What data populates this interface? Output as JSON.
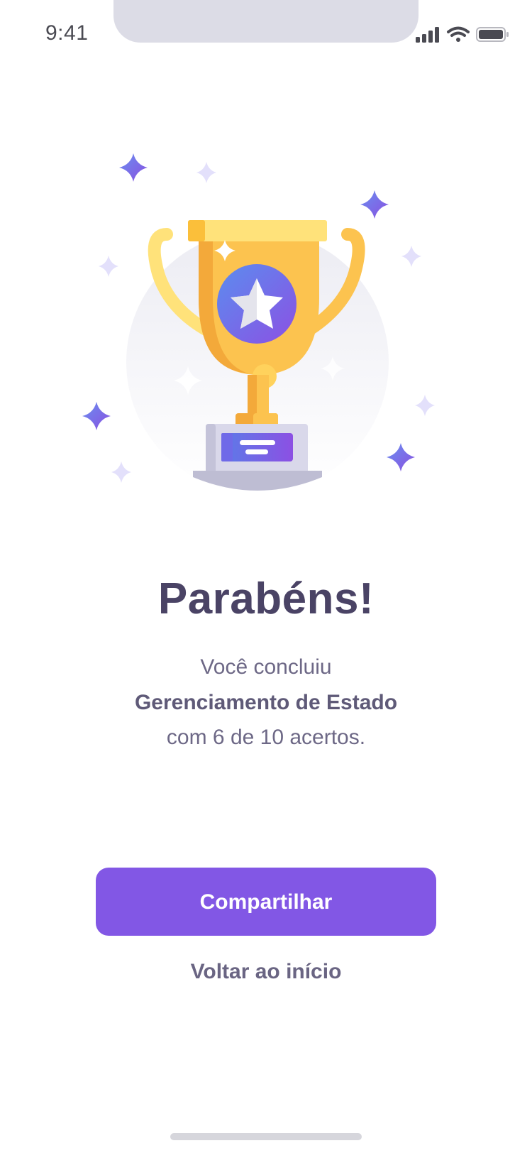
{
  "status_bar": {
    "time": "9:41"
  },
  "result": {
    "title": "Parabéns!",
    "line1": "Você concluiu",
    "quiz_name": "Gerenciamento de Estado",
    "score_text": "com 6 de 10 acertos."
  },
  "actions": {
    "share_label": "Compartilhar",
    "back_label": "Voltar ao início"
  },
  "colors": {
    "accent": "#8257e5",
    "title": "#4a4365",
    "text": "#6d6886",
    "trophy_gold": "#fcc34f",
    "trophy_dark": "#f3a93a"
  },
  "icons": {
    "illustration": "trophy-illustration",
    "badge": "star-icon",
    "signal": "cellular-signal-icon",
    "wifi": "wifi-icon",
    "battery": "battery-icon"
  }
}
